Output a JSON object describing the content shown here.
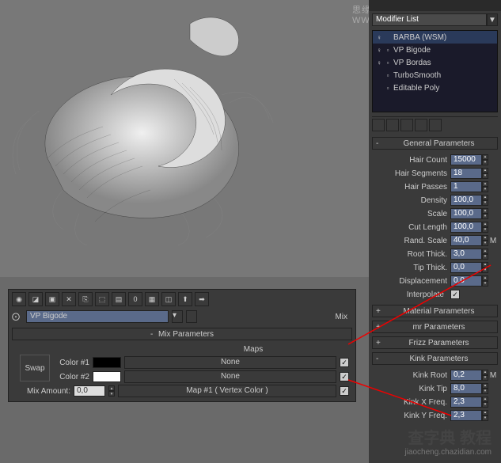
{
  "watermark": {
    "top": "思缘设计论坛 WWW.MISSYUAN.COM",
    "br_cn": "查字典 教程",
    "br_url": "jiaocheng.chazidian.com"
  },
  "modifier": {
    "list_label": "Modifier List",
    "stack": [
      {
        "name": "BARBA (WSM)",
        "expandable": false
      },
      {
        "name": "VP Bigode",
        "expandable": true
      },
      {
        "name": "VP Bordas",
        "expandable": true
      },
      {
        "name": "TurboSmooth",
        "expandable": true
      },
      {
        "name": "Editable Poly",
        "expandable": true
      }
    ]
  },
  "rollouts": {
    "general": "General Parameters",
    "material": "Material Parameters",
    "mr": "mr Parameters",
    "frizz": "Frizz Parameters",
    "kink": "Kink Parameters"
  },
  "general_params": {
    "hair_count": {
      "label": "Hair Count",
      "value": "15000"
    },
    "hair_segments": {
      "label": "Hair Segments",
      "value": "18"
    },
    "hair_passes": {
      "label": "Hair Passes",
      "value": "1"
    },
    "density": {
      "label": "Density",
      "value": "100,0"
    },
    "scale": {
      "label": "Scale",
      "value": "100,0"
    },
    "cut_length": {
      "label": "Cut Length",
      "value": "100,0"
    },
    "rand_scale": {
      "label": "Rand. Scale",
      "value": "40,0",
      "suffix": "M"
    },
    "root_thick": {
      "label": "Root Thick.",
      "value": "3,0"
    },
    "tip_thick": {
      "label": "Tip Thick.",
      "value": "0,0"
    },
    "displacement": {
      "label": "Displacement",
      "value": "0,0"
    },
    "interpolate": {
      "label": "Interpolate",
      "checked": true
    }
  },
  "kink_params": {
    "kink_root": {
      "label": "Kink Root",
      "value": "0,2",
      "suffix": "M"
    },
    "kink_tip": {
      "label": "Kink Tip",
      "value": "8,0"
    },
    "kink_x": {
      "label": "Kink X Freq.",
      "value": "2,3"
    },
    "kink_y": {
      "label": "Kink Y Freq.",
      "value": "2,3"
    }
  },
  "mix_panel": {
    "material_name": "VP Bigode",
    "mix_btn": "Mix",
    "title": "Mix Parameters",
    "maps_label": "Maps",
    "swap": "Swap",
    "color1": {
      "label": "Color #1",
      "swatch": "#000000",
      "map": "None",
      "checked": true
    },
    "color2": {
      "label": "Color #2",
      "swatch": "#ffffff",
      "map": "None",
      "checked": true
    },
    "mix_amount": {
      "label": "Mix Amount:",
      "value": "0,0",
      "map": "Map #1 ( Vertex Color )",
      "checked": true
    }
  }
}
